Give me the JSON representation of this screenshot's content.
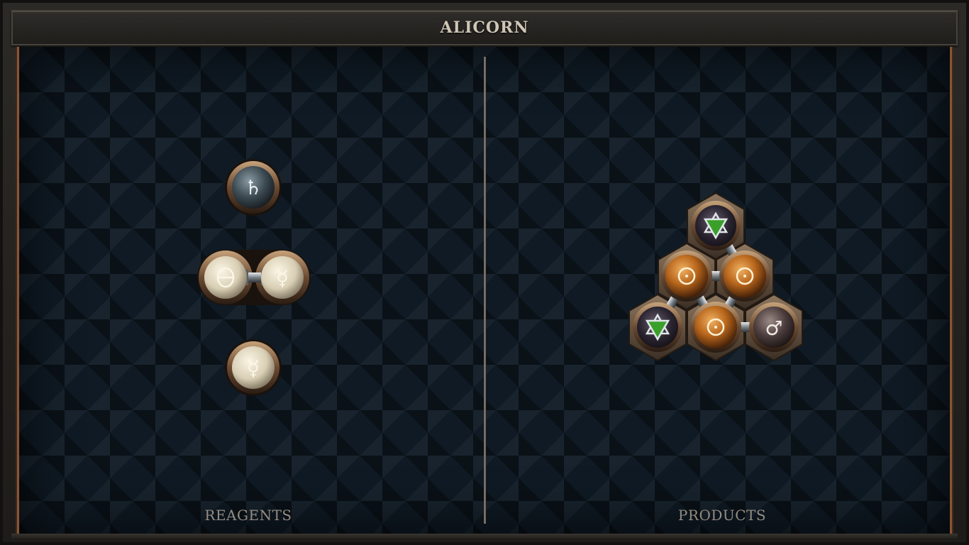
{
  "window": {
    "title": "ALICORN"
  },
  "sections": {
    "reagents": {
      "label": "REAGENTS"
    },
    "products": {
      "label": "PRODUCTS"
    }
  },
  "reagents": [
    {
      "name": "reagent-lead",
      "symbols": [
        "♄"
      ],
      "element": "lead"
    },
    {
      "name": "reagent-salt-quicksilver",
      "symbols": [
        "🜔",
        "☿"
      ],
      "element": "salt+quicksilver",
      "bonded": true
    },
    {
      "name": "reagent-quicksilver",
      "symbols": [
        "☿"
      ],
      "element": "quicksilver"
    }
  ],
  "product": {
    "name": "alicorn-molecule",
    "atoms": [
      {
        "id": "vitae-top",
        "symbol": "✡",
        "element": "vitae"
      },
      {
        "id": "gold-left",
        "symbol": "☉",
        "element": "gold"
      },
      {
        "id": "gold-right",
        "symbol": "☉",
        "element": "gold"
      },
      {
        "id": "vitae-left",
        "symbol": "✡",
        "element": "vitae"
      },
      {
        "id": "gold-bottom",
        "symbol": "☉",
        "element": "gold"
      },
      {
        "id": "iron-right",
        "symbol": "♂",
        "element": "iron"
      }
    ]
  },
  "colors": {
    "accent_copper": "#8a5433",
    "board": "#0f1a24",
    "label": "#948c82",
    "title": "#cfc6b6",
    "gold_atom": "#b8661c",
    "salt_atom": "#d9d0b8",
    "lead_atom": "#44525a",
    "iron_atom": "#4a3c3c"
  }
}
